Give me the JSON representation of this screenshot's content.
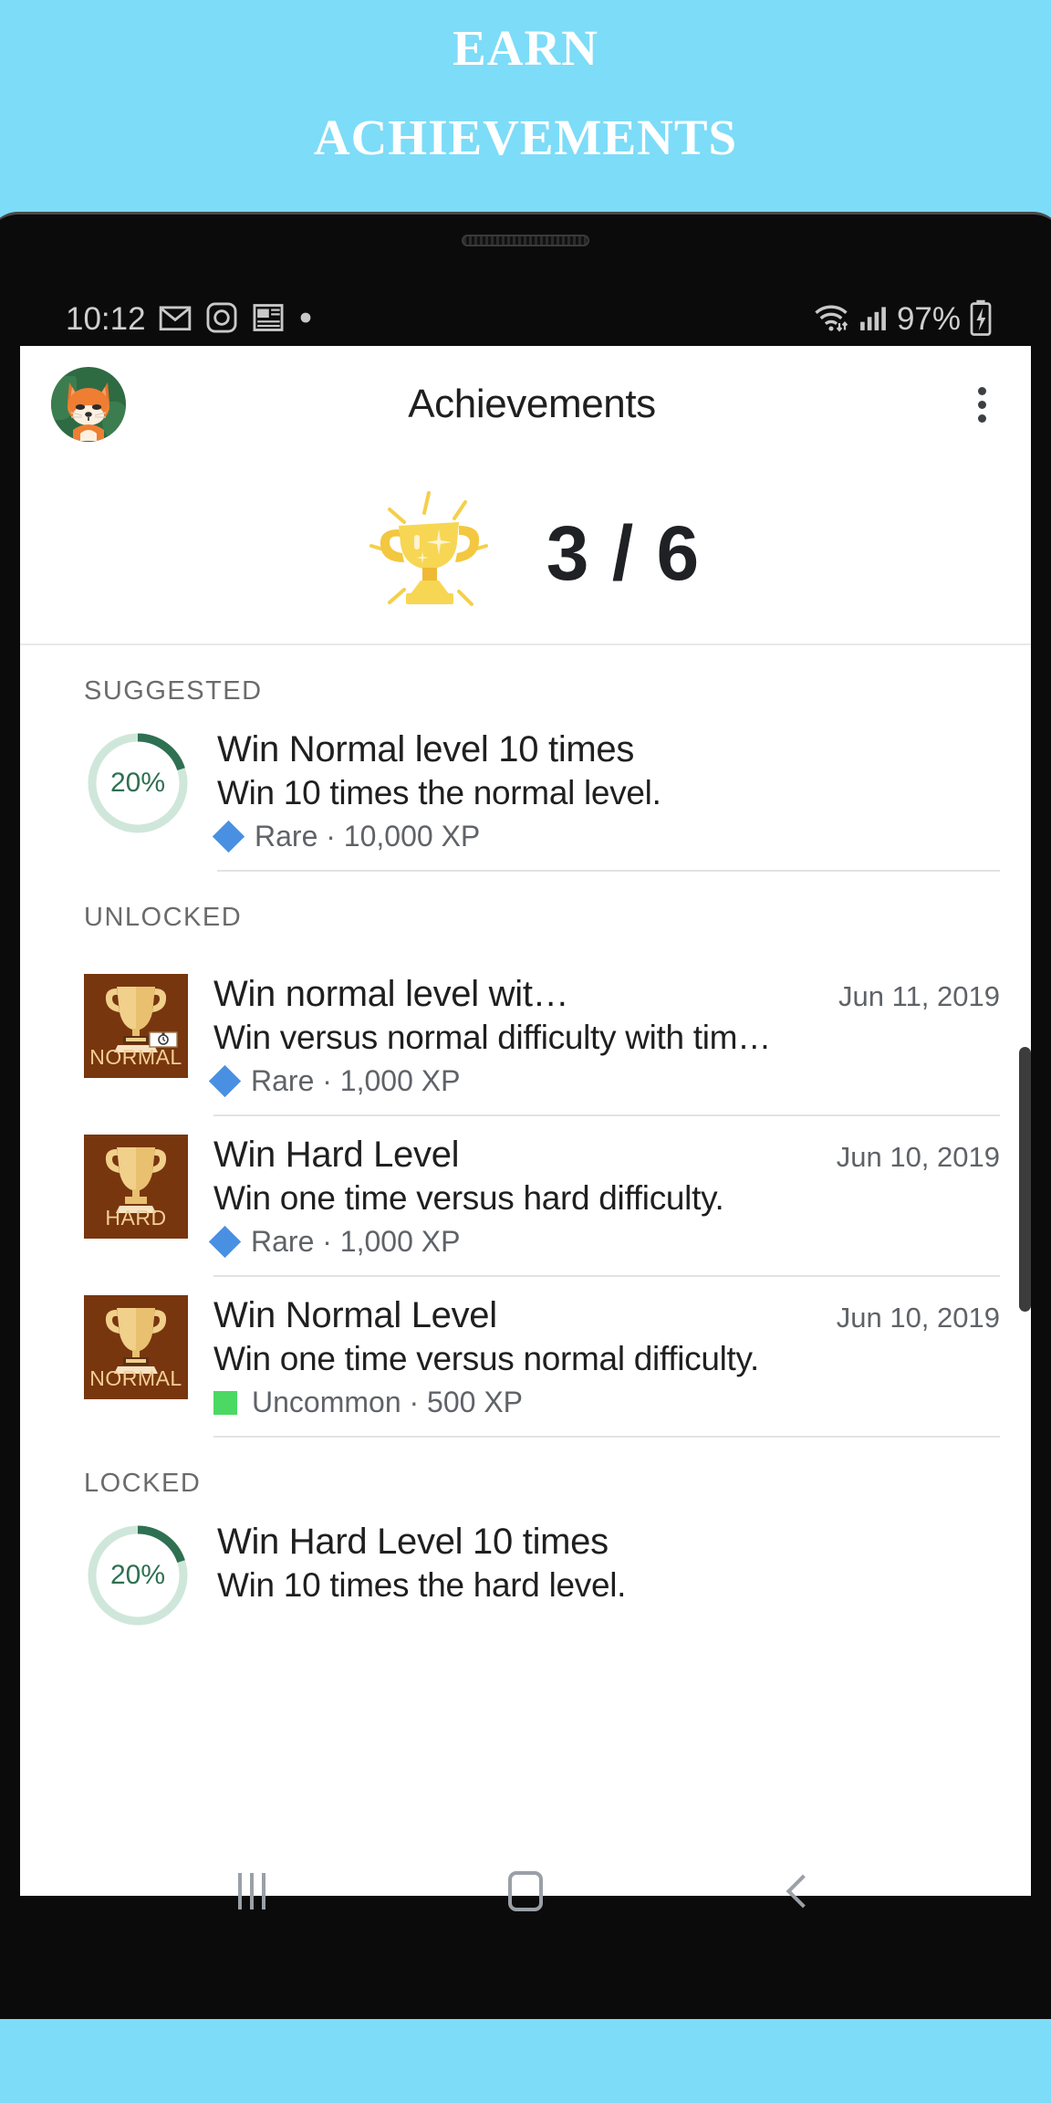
{
  "banner": {
    "line1": "Earn",
    "line2": "Achievements",
    "bg_color": "#7ddcf8",
    "text_color": "#ffffff"
  },
  "status_bar": {
    "time": "10:12",
    "icons": [
      "gmail-icon",
      "instagram-icon",
      "news-icon",
      "dot-icon"
    ],
    "wifi": "wifi-icon",
    "signal": "cellular-signal-icon",
    "battery_percent": "97%",
    "battery": "battery-charging-icon"
  },
  "app_bar": {
    "avatar": "fox-avatar",
    "title": "Achievements",
    "overflow": "more-options-icon"
  },
  "score": {
    "trophy": "trophy-icon",
    "value": "3 / 6"
  },
  "sections": [
    {
      "label": "SUGGESTED",
      "items": [
        {
          "kind": "progress",
          "progress_label": "20%",
          "progress_percent": 20,
          "title": "Win Normal level 10 times",
          "description": "Win 10 times the normal level.",
          "rarity": "Rare",
          "rarity_color": "#4a90e2",
          "rarity_shape": "diamond",
          "xp": "10,000 XP",
          "meta": "Rare · 10,000 XP",
          "date": ""
        }
      ]
    },
    {
      "label": "UNLOCKED",
      "items": [
        {
          "kind": "badge",
          "badge_label": "NORMAL",
          "badge_color": "#78360f",
          "badge_extra_icon": "stopwatch-icon",
          "title": "Win normal level wit…",
          "description": "Win versus normal difficulty with tim…",
          "rarity": "Rare",
          "rarity_color": "#4a90e2",
          "rarity_shape": "diamond",
          "xp": "1,000 XP",
          "meta": "Rare · 1,000 XP",
          "date": "Jun 11, 2019"
        },
        {
          "kind": "badge",
          "badge_label": "HARD",
          "badge_color": "#78360f",
          "badge_extra_icon": "",
          "title": "Win Hard Level",
          "description": "Win one time versus hard difficulty.",
          "rarity": "Rare",
          "rarity_color": "#4a90e2",
          "rarity_shape": "diamond",
          "xp": "1,000 XP",
          "meta": "Rare · 1,000 XP",
          "date": "Jun 10, 2019"
        },
        {
          "kind": "badge",
          "badge_label": "NORMAL",
          "badge_color": "#78360f",
          "badge_extra_icon": "",
          "title": "Win Normal Level",
          "description": "Win one time versus normal difficulty.",
          "rarity": "Uncommon",
          "rarity_color": "#4bd863",
          "rarity_shape": "square",
          "xp": "500 XP",
          "meta": "Uncommon · 500 XP",
          "date": "Jun 10, 2019"
        }
      ]
    },
    {
      "label": "LOCKED",
      "items": [
        {
          "kind": "progress",
          "progress_label": "20%",
          "progress_percent": 20,
          "title": "Win Hard Level 10 times",
          "description": "Win 10 times the hard level.",
          "rarity": "",
          "rarity_color": "",
          "rarity_shape": "",
          "xp": "",
          "meta": "",
          "date": ""
        }
      ]
    }
  ],
  "nav_bar": {
    "recents": "recents-icon",
    "home": "home-icon",
    "back": "back-icon"
  }
}
